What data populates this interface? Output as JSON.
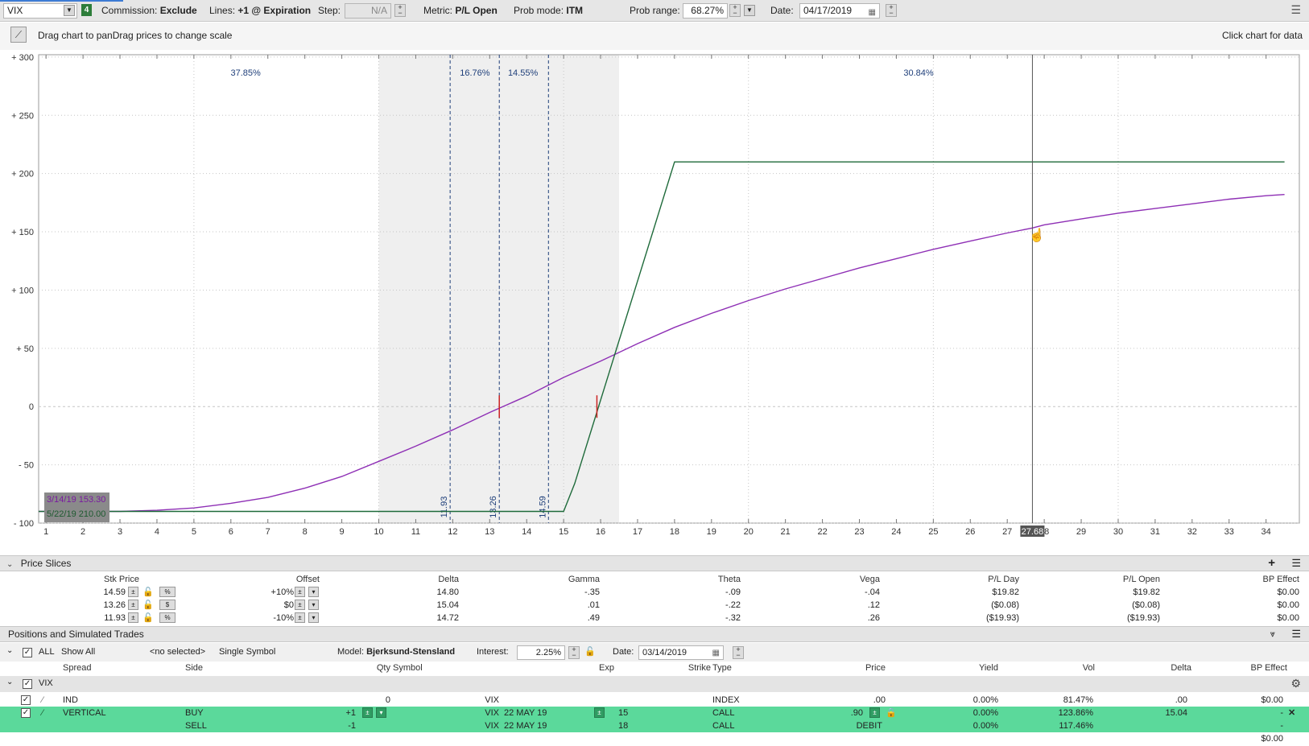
{
  "toolbar": {
    "symbol": "VIX",
    "symbol_count_badge": "4",
    "commission_label": "Commission:",
    "commission_value": "Exclude",
    "lines_label": "Lines:",
    "lines_value": "+1 @ Expiration",
    "step_label": "Step:",
    "step_value": "N/A",
    "metric_label": "Metric:",
    "metric_value": "P/L Open",
    "prob_mode_label": "Prob mode:",
    "prob_mode_value": "ITM",
    "prob_range_label": "Prob range:",
    "prob_range_value": "68.27%",
    "date_label": "Date:",
    "date_value": "04/17/2019"
  },
  "subbar": {
    "hint_left": "Drag chart to panDrag prices to change scale",
    "hint_right": "Click chart for data"
  },
  "chart_data": {
    "type": "line",
    "x_ticks": [
      1,
      2,
      3,
      4,
      5,
      6,
      7,
      8,
      9,
      10,
      11,
      12,
      13,
      14,
      15,
      16,
      17,
      18,
      19,
      20,
      21,
      22,
      23,
      24,
      25,
      26,
      27,
      28,
      29,
      30,
      31,
      32,
      33,
      34
    ],
    "y_ticks": [
      "+ 300",
      "+ 250",
      "+ 200",
      "+ 150",
      "+ 100",
      "+ 50",
      "0",
      "- 50",
      "- 100"
    ],
    "y_tick_values": [
      300,
      250,
      200,
      150,
      100,
      50,
      0,
      -50,
      -100
    ],
    "xlim": [
      0.8,
      34.9
    ],
    "ylim": [
      -100,
      302
    ],
    "shaded_range": [
      10,
      16.5
    ],
    "probability_labels": [
      {
        "x": 6.4,
        "text": "37.85%"
      },
      {
        "x": 12.6,
        "text": "16.76%"
      },
      {
        "x": 13.9,
        "text": "14.55%"
      },
      {
        "x": 24.6,
        "text": "30.84%"
      }
    ],
    "price_lines": [
      {
        "x": 11.93,
        "label": "11.93"
      },
      {
        "x": 13.26,
        "label": "13.26"
      },
      {
        "x": 14.59,
        "label": "14.59"
      }
    ],
    "breakeven_marks": [
      13.26,
      15.9
    ],
    "cursor": {
      "x": 27.68,
      "label": "27.68"
    },
    "series": [
      {
        "name": "3/14/19",
        "color": "#8e2fb5",
        "x": [
          0.8,
          3,
          4,
          5,
          6,
          7,
          8,
          9,
          10,
          11,
          12,
          13,
          14,
          15,
          16,
          17,
          18,
          19,
          20,
          21,
          22,
          23,
          24,
          25,
          26,
          27,
          27.68,
          28,
          29,
          30,
          31,
          32,
          33,
          34,
          34.5
        ],
        "y": [
          -90,
          -90,
          -89,
          -87,
          -83,
          -78,
          -70,
          -60,
          -47,
          -34,
          -20,
          -5,
          9,
          25,
          39,
          54,
          68,
          80,
          91,
          101,
          110,
          119,
          127,
          135,
          142,
          149,
          153.3,
          156,
          161,
          166,
          170,
          174,
          178,
          181,
          182
        ]
      },
      {
        "name": "5/22/19",
        "color": "#1e6a3a",
        "x": [
          0.8,
          15,
          15.3,
          18,
          34.5
        ],
        "y": [
          -90,
          -90,
          -66,
          210,
          210
        ]
      }
    ],
    "readout": [
      {
        "text": "3/14/19  153.30",
        "color": "#7a1aa0"
      },
      {
        "text": "5/22/19  210.00",
        "color": "#1e5a30"
      }
    ]
  },
  "price_slices": {
    "title": "Price Slices",
    "headers": [
      "Stk Price",
      "Offset",
      "Delta",
      "Gamma",
      "Theta",
      "Vega",
      "P/L Day",
      "P/L Open",
      "BP Effect"
    ],
    "rows": [
      {
        "stk": "14.59",
        "mode": "%",
        "offset": "+10%",
        "delta": "14.80",
        "gamma": "-.35",
        "theta": "-.09",
        "vega": "-.04",
        "pl_day": "$19.82",
        "pl_open": "$19.82",
        "bp": "$0.00"
      },
      {
        "stk": "13.26",
        "mode": "$",
        "offset": "$0",
        "delta": "15.04",
        "gamma": ".01",
        "theta": "-.22",
        "vega": ".12",
        "pl_day": "($0.08)",
        "pl_open": "($0.08)",
        "bp": "$0.00"
      },
      {
        "stk": "11.93",
        "mode": "%",
        "offset": "-10%",
        "delta": "14.72",
        "gamma": ".49",
        "theta": "-.32",
        "vega": ".26",
        "pl_day": "($19.93)",
        "pl_open": "($19.93)",
        "bp": "$0.00"
      }
    ]
  },
  "positions": {
    "title": "Positions and Simulated Trades",
    "filter_all": "ALL",
    "show_all": "Show All",
    "no_selected": "<no selected>",
    "single_symbol": "Single Symbol",
    "model_label": "Model:",
    "model_value": "Bjerksund-Stensland",
    "interest_label": "Interest:",
    "interest_value": "2.25%",
    "date_label": "Date:",
    "date_value": "03/14/2019",
    "headers": [
      "Spread",
      "Side",
      "Qty",
      "Symbol",
      "Exp",
      "Strike",
      "Type",
      "Price",
      "Yield",
      "Vol",
      "Delta",
      "BP Effect"
    ],
    "group": "VIX",
    "ind_row": {
      "spread": "IND",
      "qty": "0",
      "symbol": "VIX",
      "type": "INDEX",
      "price": ".00",
      "yield": "0.00%",
      "vol": "81.47%",
      "delta": ".00",
      "bp": "$0.00"
    },
    "buy_row": {
      "spread": "VERTICAL",
      "side": "BUY",
      "qty": "+1",
      "symbol": "VIX",
      "exp": "22 MAY 19",
      "strike": "15",
      "type": "CALL",
      "price": ".90",
      "yield": "0.00%",
      "vol": "123.86%",
      "delta": "15.04",
      "bp": "-"
    },
    "sell_row": {
      "side": "SELL",
      "qty": "-1",
      "symbol": "VIX",
      "exp": "22 MAY 19",
      "strike": "18",
      "type": "CALL",
      "price": "DEBIT",
      "yield": "0.00%",
      "vol": "117.46%",
      "bp": "-"
    },
    "total_bp": "$0.00"
  }
}
